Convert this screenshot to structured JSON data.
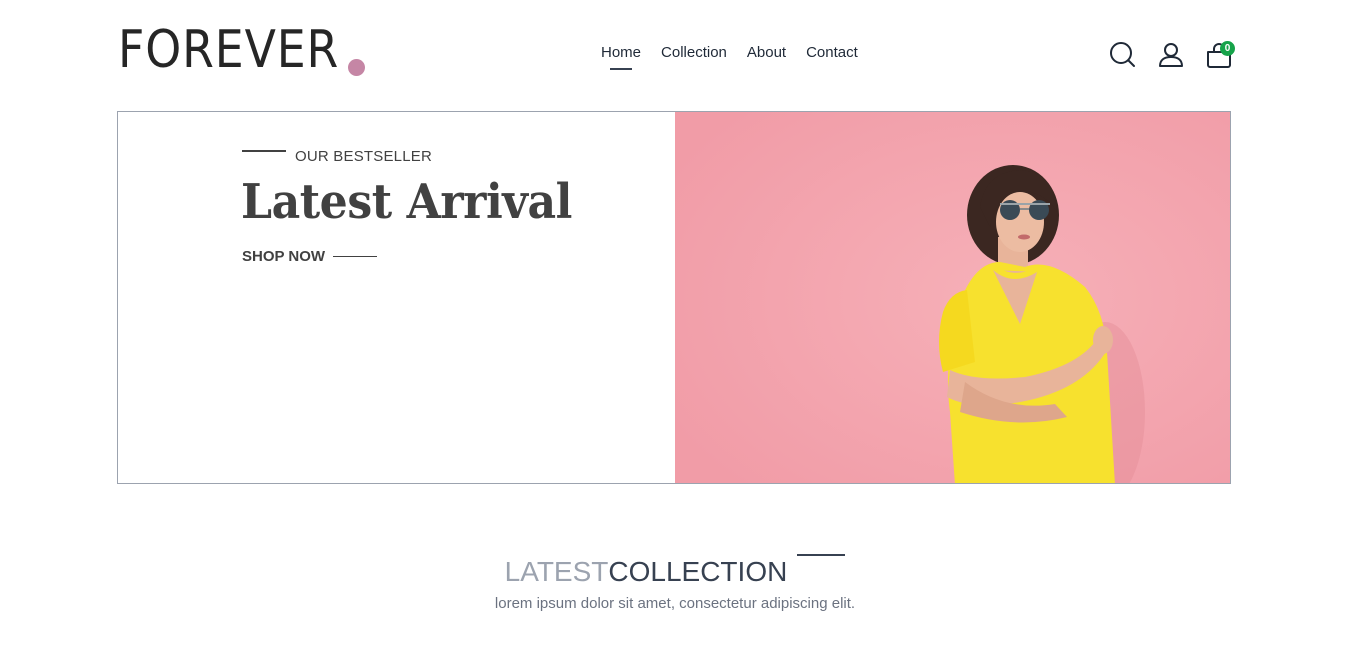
{
  "header": {
    "logo_text": "FOREVER",
    "nav": [
      {
        "label": "Home",
        "active": true
      },
      {
        "label": "Collection"
      },
      {
        "label": "About"
      },
      {
        "label": "Contact"
      }
    ],
    "icons": [
      "search-icon",
      "user-icon",
      "cart-icon"
    ],
    "cart_count": "0"
  },
  "hero": {
    "eyebrow": "OUR BESTSELLER",
    "title": "Latest Arrival",
    "cta": "SHOP NOW",
    "bg_color": "#f4a5ae"
  },
  "collection": {
    "title_light": "LATEST",
    "title_dark": "COLLECTION",
    "subtitle": "lorem ipsum dolor sit amet, consectetur adipiscing elit."
  },
  "colors": {
    "accent_dot": "#c586a5",
    "badge": "#16a34a",
    "text": "#414141"
  }
}
